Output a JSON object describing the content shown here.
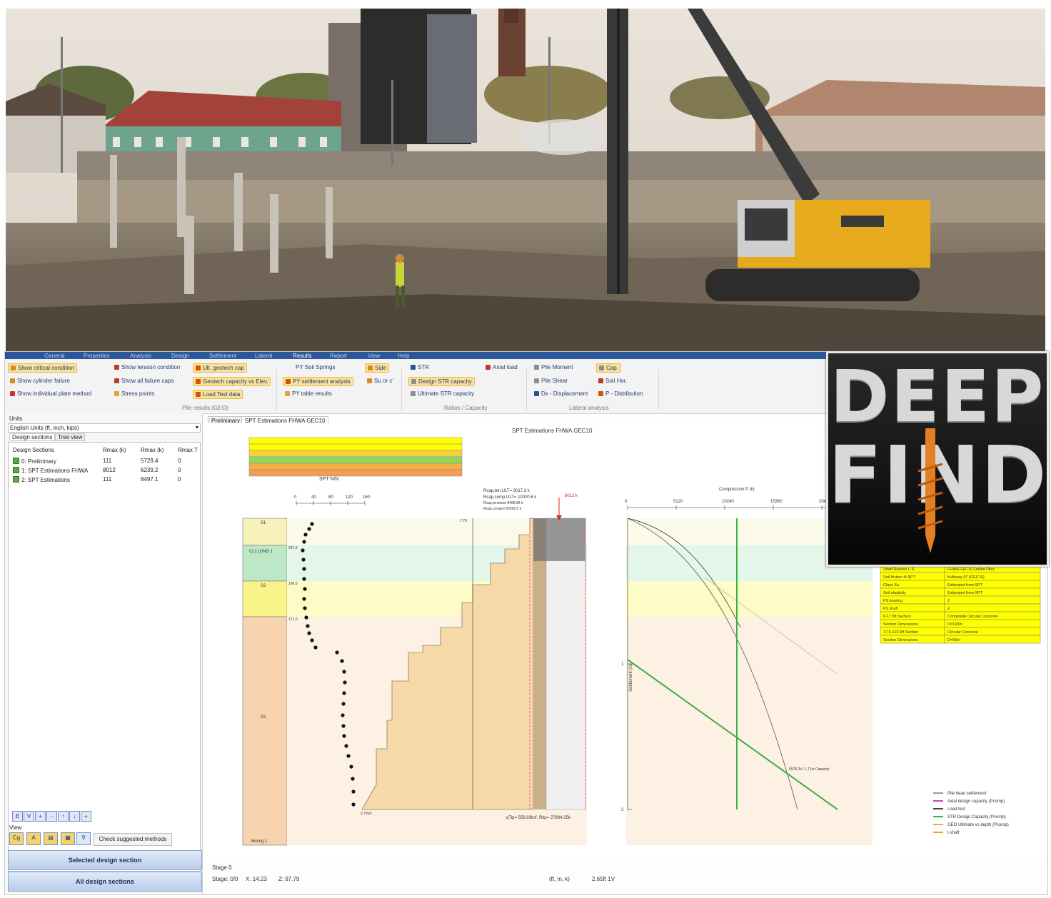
{
  "ribbon": {
    "tabs": [
      "General",
      "Properties",
      "Analysis",
      "Design",
      "Settlement",
      "Lateral",
      "Results",
      "Report",
      "View",
      "Help"
    ],
    "buttons": {
      "critical": "Show critical condition",
      "cylinder": "Show cylinder failure",
      "plate": "Show individual plate method",
      "tension": "Show tension condition",
      "all_caps": "Show all failure caps",
      "stress": "Stress points",
      "ult_cap": "Ult. geotech cap",
      "geo_elev": "Geotech capacity vs Elev.",
      "load_test": "Load Test data",
      "py_springs": "PY Soil Springs",
      "py_settle": "PY settlement analysis",
      "py_table": "PY table results",
      "side": "Side",
      "su": "Su or c'",
      "str": "STR",
      "axial": "Axial load",
      "design_str": "Design STR capacity",
      "ult_str": "Ultimate STR capacity",
      "pile_moment": "Pile Moment",
      "pile_shear": "Pile Shear",
      "dx": "Dx - Displacement",
      "cap": "Cap.",
      "soil_hor": "Soil Hor.",
      "p_dist": "P - Distribution"
    },
    "groups": {
      "pile_results": "Pile results (GEO)",
      "ratios": "Ratios / Capacity",
      "lateral": "Lateral analysis"
    }
  },
  "left": {
    "units_label": "Units",
    "units_value": "English Units (ft, inch, kips)",
    "tabs": [
      "Design sections",
      "Tree view"
    ],
    "headers": [
      "Design Sections",
      "Rmax (k)",
      "Rmax (k)",
      "Rmax T"
    ],
    "rows": [
      {
        "name": "0: Preliminary",
        "c1": "111",
        "c2": "5729.4",
        "c3": "0"
      },
      {
        "name": "1: SPT Estimations FHWA",
        "c1": "8012",
        "c2": "6239.2",
        "c3": "0"
      },
      {
        "name": "2: SPT Estimations",
        "c1": "111",
        "c2": "8497.1",
        "c3": "0"
      }
    ],
    "mini_buttons": [
      "E",
      "V",
      "+",
      "-",
      "↑",
      "↓",
      "+"
    ],
    "view_label": "View",
    "check_button": "Check suggested methods",
    "selected_button": "Selected design section",
    "all_button": "All design sections"
  },
  "content": {
    "tabs": [
      "Preliminary",
      "SPT Estimations FHWA GEC10"
    ],
    "chart_title": "SPT Estimations FHWA GEC10",
    "spt_label": "SPT N/N",
    "spt_ticks": [
      "0",
      "40",
      "80",
      "120",
      "160"
    ],
    "annot": [
      "Rcap,ten,ULT= 3017.3 k",
      "Rcap,comp,ULT= 10000.6 k",
      "Rcap,tensione 8498.99 k",
      "Rcap,compre 82669.3 k"
    ],
    "marker": "8012 k",
    "layers": [
      "S1",
      "CL1 (UNO 1",
      "S2",
      "S3",
      "Boring 1"
    ],
    "elevs": [
      "257.0",
      "196.0",
      "171.0",
      "7.79",
      "2.7%of"
    ],
    "rtip": "qTip= 556.93ksf, Rtip= 27884.35k",
    "comp_label": "Compression P (k)",
    "comp_ticks": [
      "0",
      "5120",
      "10240",
      "15360",
      "20480"
    ],
    "settle_label": "Settlement (in)",
    "settle_ticks": [
      "1",
      "2"
    ],
    "sett_annot": "5978.2k / 1.71in\nCapacity",
    "legend": [
      "Pile head settlement",
      "Axial design capacity (Pcomp)",
      "Load test",
      "STR Design Capacity (Pcomp)",
      "GEO Ultimate vs depth (Pcomp)",
      "t-shaft"
    ],
    "props": [
      [
        "Shaft Reduce L.S.",
        "FHWA GEC10-Drilled Piles"
      ],
      [
        "Soil friction Φ SPT",
        "Kulhawy 07 (GEC10)"
      ],
      [
        "Clays Su",
        "Estimated from SPT"
      ],
      [
        "Soil elasticity",
        "Estimated from SPT"
      ],
      [
        "FS bearing",
        "2"
      ],
      [
        "FS shaft",
        "2"
      ],
      [
        "0-17.5ft Section",
        "Composite Circular Concrete"
      ],
      [
        "Section Dimensions",
        "D=100in"
      ],
      [
        "17.5-122.5ft Section",
        "Circular Concrete"
      ],
      [
        "Section Dimensions",
        "D=96in"
      ]
    ]
  },
  "status": {
    "stage_label": "Stage 0",
    "stage": "Stage: 0/0",
    "x": "X: 14.23",
    "z": "Z: 97.79",
    "units": "(ft, in, k)",
    "value": "2.65ft 1V"
  },
  "logo": {
    "line1": "DEEP",
    "line2": "FIND"
  },
  "colors": {
    "ribbon_tab": "#2b579a",
    "highlight": "#fbe29a",
    "props_yellow": "#ffff00",
    "logo_orange": "#e67e22"
  }
}
